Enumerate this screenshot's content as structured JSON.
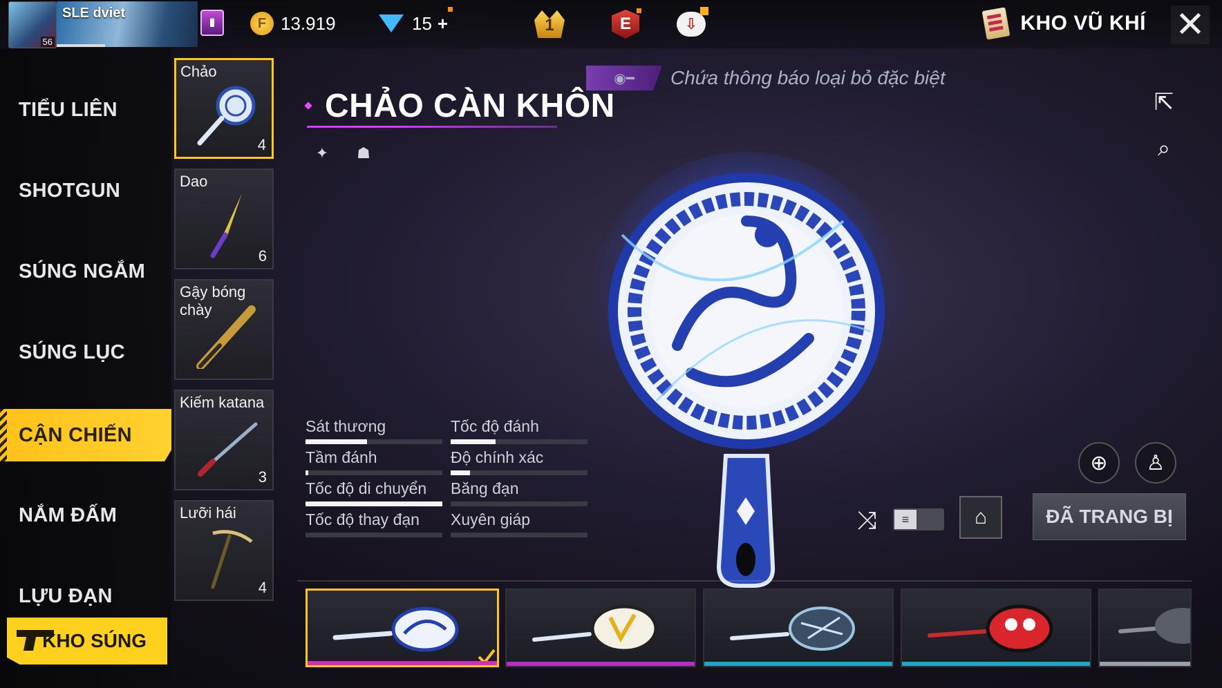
{
  "topbar": {
    "player_name": "SLE dviet",
    "player_level": "56",
    "gold": "13.919",
    "diamonds": "15",
    "diamonds_add": "+",
    "rank_value": "1",
    "elite_label": "E",
    "screen_title": "KHO VŨ KHÍ",
    "close_icon": "✕"
  },
  "categories": [
    {
      "label": "TIỂU LIÊN",
      "active": false
    },
    {
      "label": "SHOTGUN",
      "active": false
    },
    {
      "label": "SÚNG NGẮM",
      "active": false
    },
    {
      "label": "SÚNG LỤC",
      "active": false
    },
    {
      "label": "CẬN CHIẾN",
      "active": true
    },
    {
      "label": "NẮM ĐẤM",
      "active": false
    },
    {
      "label": "LỰU ĐẠN",
      "active": false
    }
  ],
  "kho_sung_button": "KHO SÚNG",
  "weapons": [
    {
      "name": "Chảo",
      "count": "4",
      "selected": true
    },
    {
      "name": "Dao",
      "count": "6",
      "selected": false
    },
    {
      "name": "Gậy bóng chày",
      "count": "",
      "selected": false
    },
    {
      "name": "Kiếm katana",
      "count": "3",
      "selected": false
    },
    {
      "name": "Lưỡi hái",
      "count": "4",
      "selected": false
    }
  ],
  "detail": {
    "notice": "Chứa thông báo loại bỏ đặc biệt",
    "title": "CHẢO CÀN KHÔN",
    "equip_button": "ĐÃ TRANG BỊ"
  },
  "stats": [
    {
      "label": "Sát thương",
      "value": 0.45
    },
    {
      "label": "Tốc độ đánh",
      "value": 0.33
    },
    {
      "label": "Tầm đánh",
      "value": 0.02
    },
    {
      "label": "Độ chính xác",
      "value": 0.14
    },
    {
      "label": "Tốc độ di chuyển",
      "value": 1.0
    },
    {
      "label": "Băng đạn",
      "value": 0.0
    },
    {
      "label": "Tốc độ thay đạn",
      "value": 0.0
    },
    {
      "label": "Xuyên giáp",
      "value": 0.0
    }
  ],
  "skins": [
    {
      "name": "dragon-porcelain-pan",
      "rarity_color": "#d22cc8",
      "selected": true
    },
    {
      "name": "skull-pan",
      "rarity_color": "#b82cc8",
      "selected": false
    },
    {
      "name": "lightning-pan",
      "rarity_color": "#20a6c4",
      "selected": false
    },
    {
      "name": "red-face-pan",
      "rarity_color": "#20a6c4",
      "selected": false
    },
    {
      "name": "gray-pan",
      "rarity_color": "#9aa0a8",
      "selected": false
    }
  ],
  "colors": {
    "accent": "#ffc61c",
    "title_underline": "#d43cff"
  }
}
